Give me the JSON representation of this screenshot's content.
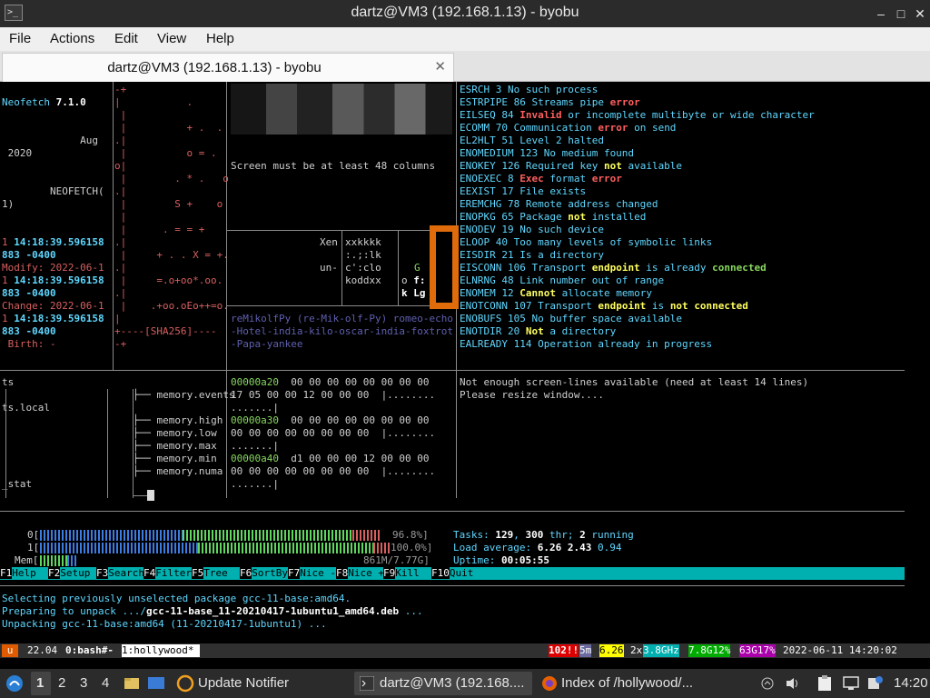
{
  "window": {
    "title": "dartz@VM3 (192.168.1.13) - byobu",
    "app_icon": ">_",
    "minimize": "–",
    "maximize": "□",
    "close": "✕"
  },
  "menu": [
    "File",
    "Actions",
    "Edit",
    "View",
    "Help"
  ],
  "tab": {
    "label": "dartz@VM3 (192.168.1.13) - byobu",
    "close": "✕"
  },
  "pane_left": {
    "lines": [
      {
        "t": "Neofetch ",
        "b": "7.1.0"
      },
      {
        "t": ""
      },
      {
        "t": "             Aug"
      },
      {
        "t": " 2020"
      },
      {
        "t": ""
      },
      {
        "t": "        NEOFETCH("
      },
      {
        "t": "1)"
      },
      {
        "t": ""
      },
      {
        "t": "1 ",
        "b": "14:18:39.596158"
      },
      {
        "t": "883 -0400",
        "b2": "883"
      },
      {
        "t": "Modify: 2022-06-1",
        "red": true
      },
      {
        "t": "1 ",
        "b": "14:18:39.596158"
      },
      {
        "t": "883 -0400",
        "b2": "883"
      },
      {
        "t": "Change: 2022-06-1",
        "red": true
      },
      {
        "t": "1 ",
        "b": "14:18:39.596158"
      },
      {
        "t": "883 -0400",
        "b2": "883"
      },
      {
        "t": " Birth: -",
        "red": true
      }
    ],
    "sha_art": [
      "-+",
      "|           .",
      " |",
      " |          + .  .",
      ".|",
      " |          o = .",
      "o|",
      " |        . * .   o",
      ".|",
      " |        S +    o",
      " |",
      " |      . = = +",
      ".|",
      " |     + . . X = +.",
      ".|",
      " |     =.o+oo*.oo.",
      ".|",
      " |    .+oo.oEo++=o.",
      "|",
      "+----[SHA256]----",
      "-+"
    ]
  },
  "pane_mid": {
    "banner": "Screen must be at least 48 columns",
    "mini_text": [
      "Xen",
      "un-"
    ],
    "mini_vals": [
      "xxkkkk",
      ":.;:lk",
      "c':clo",
      "koddxx"
    ],
    "mini_right": [
      "G",
      "f:",
      "Lg",
      "o",
      "k"
    ],
    "phonetic": "reMikolfPy (re-Mik-olf-Py) romeo-echo-Hotel-india-kilo-oscar-india-foxtrot-Papa-yankee"
  },
  "pane_errno": {
    "lines": [
      "ESRCH 3 No such process",
      "ESTRPIPE 86 Streams pipe |error|",
      "EILSEQ 84 |Invalid| or incomplete multibyte or wide character",
      "ECOMM 70 Communication |error| on send",
      "EL2HLT 51 Level 2 halted",
      "ENOMEDIUM 123 No medium found",
      "ENOKEY 126 Required key ^not^ available",
      "ENOEXEC 8 |Exec| format |error|",
      "EEXIST 17 File exists",
      "EREMCHG 78 Remote address changed",
      "ENOPKG 65 Package ^not^ installed",
      "ENODEV 19 No such device",
      "ELOOP 40 Too many levels of symbolic links",
      "EISDIR 21 Is a directory",
      "EISCONN 106 Transport ^endpoint^ is already ~connected~",
      "ELNRNG 48 Link number out of range",
      "ENOMEM 12 ^Cannot^ allocate memory",
      "ENOTCONN 107 Transport ^endpoint^ is ^not^ ^connected^",
      "ENOBUFS 105 No buffer space available",
      "ENOTDIR 20 ^Not^ a directory",
      "EALREADY 114 Operation already in progress"
    ]
  },
  "pane_tree": {
    "left_lines": [
      "ts",
      "",
      "ts.local",
      "",
      "",
      "",
      "",
      "",
      "_stat"
    ],
    "tree": [
      "memory.events",
      "memory.high",
      "memory.low",
      "memory.max",
      "memory.min",
      "memory.numa"
    ]
  },
  "pane_hex": {
    "lines": [
      {
        "a": "00000a20",
        "h": "  00 00 00 00 00 00 00 00"
      },
      {
        "a": "",
        "h": "17 05 00 00 12 00 00 00  |........"
      },
      {
        "a": "",
        "h": ".......|"
      },
      {
        "a": "00000a30",
        "h": "  00 00 00 00 00 00 00 00"
      },
      {
        "a": "",
        "h": "00 00 00 00 00 00 00 00  |........"
      },
      {
        "a": "",
        "h": ".......|"
      },
      {
        "a": "00000a40",
        "h": "  d1 00 00 00 12 00 00 00"
      },
      {
        "a": "",
        "h": "00 00 00 00 00 00 00 00  |........"
      },
      {
        "a": "",
        "h": ".......|"
      }
    ]
  },
  "pane_resize": {
    "lines": [
      "Not enough screen-lines available (need at least 14 lines)",
      "Please resize window...."
    ]
  },
  "htop": {
    "cpu0_label": "0[",
    "cpu0_pct": "96.8%]",
    "cpu0_value": 0.968,
    "cpu1_label": "1[",
    "cpu1_pct": "100.0%]",
    "cpu1_value": 1.0,
    "mem_label": "Mem[",
    "mem_value": "861M/7.77G]",
    "mem_fraction": 0.11,
    "tasks_label": "Tasks: ",
    "tasks": "129",
    "thr": "300",
    "thr_label": " thr; ",
    "running": "2",
    "running_label": " running",
    "load_label": "Load average: ",
    "load1": "6.26",
    "load5": "2.43",
    "load15": "0.94",
    "uptime_label": "Uptime: ",
    "uptime": "00:05:55"
  },
  "fkeys": [
    {
      "k": "F1",
      "l": "Help  "
    },
    {
      "k": "F2",
      "l": "Setup "
    },
    {
      "k": "F3",
      "l": "Search"
    },
    {
      "k": "F4",
      "l": "Filter"
    },
    {
      "k": "F5",
      "l": "Tree  "
    },
    {
      "k": "F6",
      "l": "SortBy"
    },
    {
      "k": "F7",
      "l": "Nice -"
    },
    {
      "k": "F8",
      "l": "Nice +"
    },
    {
      "k": "F9",
      "l": "Kill  "
    },
    {
      "k": "F10",
      "l": "Quit"
    }
  ],
  "apt": {
    "line1": "Selecting previously unselected package gcc-11-base:amd64.",
    "line2a": "Preparing to unpack .../",
    "line2b": "gcc-11-base_11-20210417-1ubuntu1_amd64.deb",
    "line2c": " ...",
    "line3": "Unpacking gcc-11-base:amd64 (11-20210417-1ubuntu1) ..."
  },
  "byobu": {
    "logo": "u",
    "version": "22.04",
    "win0": "0:bash#-",
    "win1": "1:hollywood*",
    "updates": "102!!",
    "mem_label": "5m",
    "load": "6.26",
    "cores": "2x",
    "freq": "3.8GHz",
    "mem": "7.8G12%",
    "disk": "63G17%",
    "datetime": "2022-06-11 14:20:02"
  },
  "taskbar": {
    "workspaces": [
      "1",
      "2",
      "3",
      "4"
    ],
    "apps": [
      {
        "label": "Update Notifier"
      },
      {
        "label": "dartz@VM3 (192.168...."
      },
      {
        "label": "Index of /hollywood/..."
      }
    ],
    "clock": "14:20"
  },
  "colors": {
    "accent_orange": "#e06b0b",
    "htop_cyan": "#00afaf"
  }
}
